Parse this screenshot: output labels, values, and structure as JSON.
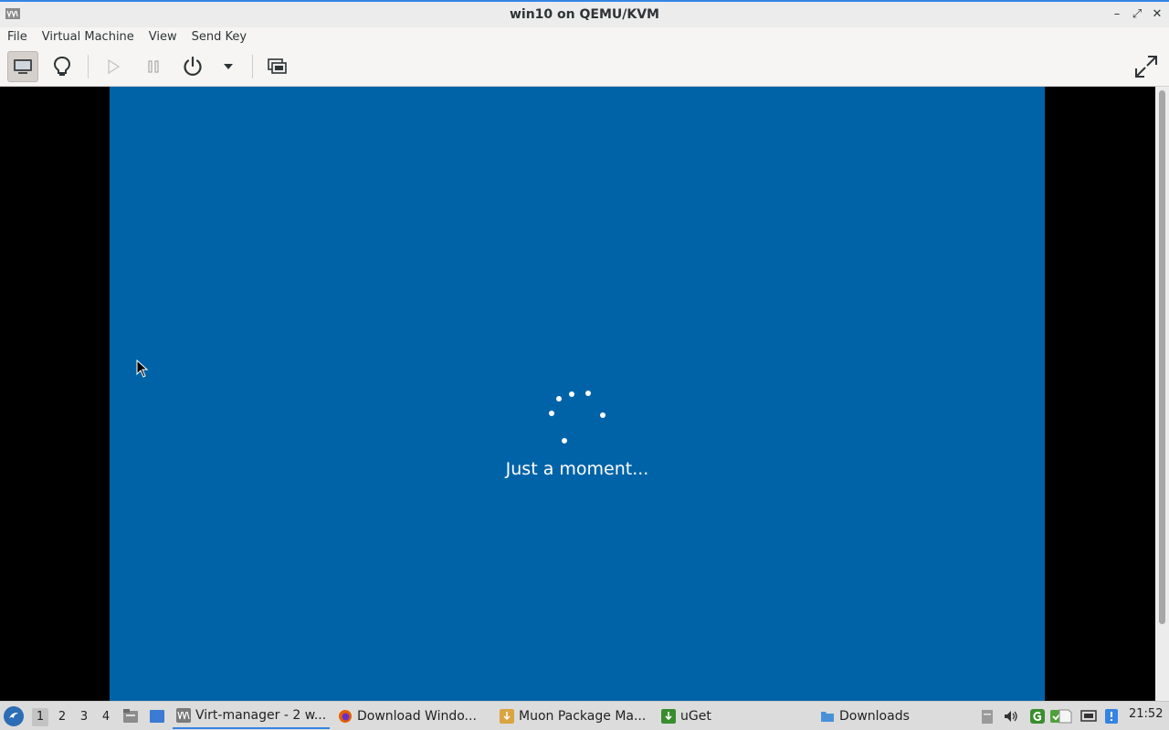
{
  "window": {
    "title": "win10 on QEMU/KVM",
    "minimize_glyph": "–",
    "maximize_glyph": "⤢",
    "close_glyph": "✕"
  },
  "menubar": {
    "items": [
      "File",
      "Virtual Machine",
      "View",
      "Send Key"
    ]
  },
  "toolbar": {
    "buttons": [
      "console-icon",
      "lightbulb-icon",
      "play-icon",
      "pause-icon",
      "power-icon",
      "dropdown-arrow-icon",
      "snapshot-icon",
      "fullscreen-icon"
    ]
  },
  "guest": {
    "message": "Just a moment...",
    "background_color": "#0063a8"
  },
  "taskbar": {
    "workspaces": [
      "1",
      "2",
      "3",
      "4"
    ],
    "tasks": [
      {
        "label": "Virt-manager - 2 w...",
        "icon": "virt-manager-icon"
      },
      {
        "label": "Download Windo...",
        "icon": "firefox-icon"
      },
      {
        "label": "Muon Package Ma...",
        "icon": "muon-icon"
      },
      {
        "label": "uGet",
        "icon": "uget-icon"
      },
      {
        "label": "Downloads",
        "icon": "folder-icon"
      }
    ],
    "clock": "21:52"
  },
  "colors": {
    "accent": "#3584e4",
    "guest_blue": "#0063a8"
  }
}
